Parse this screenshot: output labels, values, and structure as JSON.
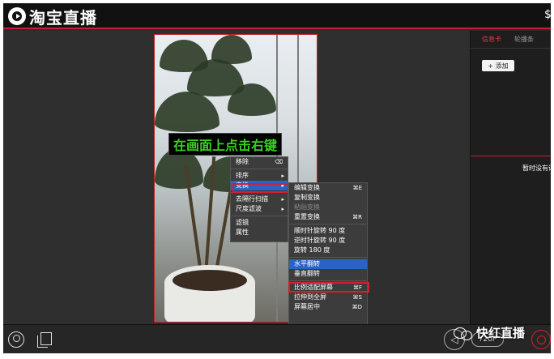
{
  "titlebar": {
    "app_name": "淘宝直播"
  },
  "preview": {
    "caption": "在画面上点击右键"
  },
  "context_menu": {
    "items": [
      {
        "label": "移除",
        "shortcut": "⌫"
      },
      {
        "label": "排序"
      },
      {
        "label": "变换"
      },
      {
        "label": "去隔行扫描"
      },
      {
        "label": "尺度滤波"
      },
      {
        "label": "滤镜"
      },
      {
        "label": "属性"
      }
    ]
  },
  "transform_submenu": {
    "items": [
      {
        "label": "编辑变换",
        "shortcut": "⌘E"
      },
      {
        "label": "复制变换",
        "shortcut": ""
      },
      {
        "label": "粘贴变换",
        "shortcut": ""
      },
      {
        "label": "重置变换",
        "shortcut": "⌘R"
      },
      {
        "label": "顺时针旋转 90 度",
        "shortcut": ""
      },
      {
        "label": "逆时针旋转 90 度",
        "shortcut": ""
      },
      {
        "label": "旋转 180 度",
        "shortcut": ""
      },
      {
        "label": "水平翻转",
        "shortcut": ""
      },
      {
        "label": "垂直翻转",
        "shortcut": ""
      },
      {
        "label": "比例适配屏幕",
        "shortcut": "⌘F"
      },
      {
        "label": "拉伸到全屏",
        "shortcut": "⌘S"
      },
      {
        "label": "屏幕居中",
        "shortcut": "⌘D"
      }
    ]
  },
  "right_panel": {
    "tabs": [
      "信息卡",
      "轮播条"
    ],
    "add_button": "+ 添加",
    "empty_note": "暂时没有评"
  },
  "bottombar": {
    "resolution": "720P"
  },
  "watermark": {
    "text": "快红直播"
  },
  "colors": {
    "accent_red": "#c8202e",
    "highlight_blue": "#2a63c8",
    "caption_green": "#39d21f"
  }
}
